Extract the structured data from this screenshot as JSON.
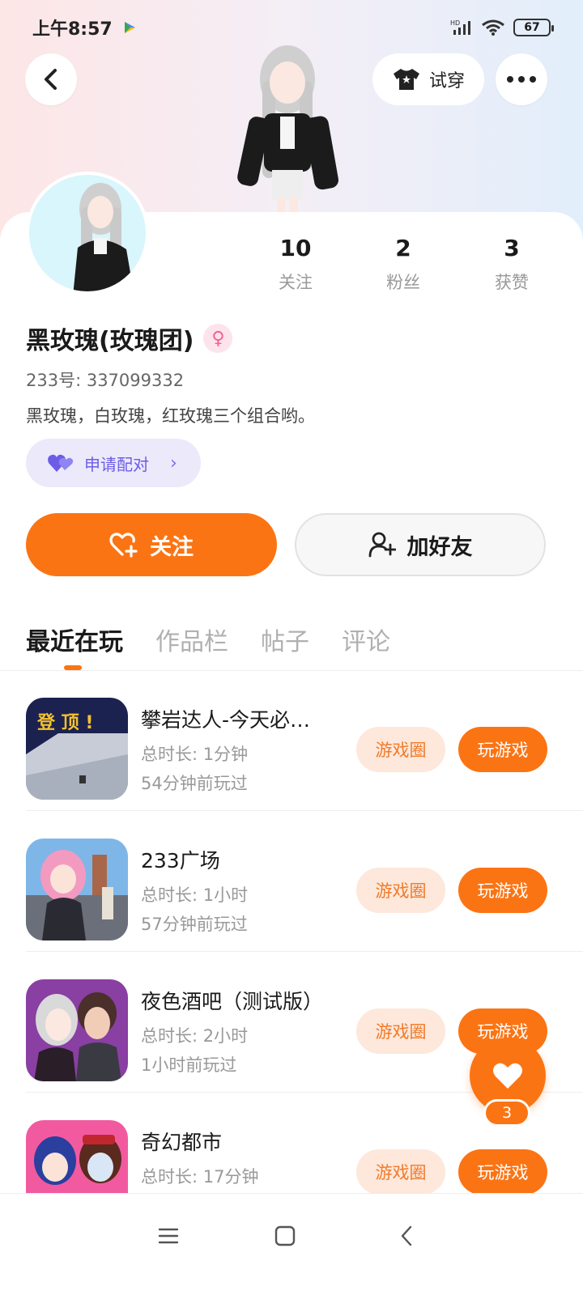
{
  "status_bar": {
    "time": "上午8:57",
    "battery": "67"
  },
  "header": {
    "tryon_label": "试穿"
  },
  "stats": [
    {
      "num": "10",
      "label": "关注"
    },
    {
      "num": "2",
      "label": "粉丝"
    },
    {
      "num": "3",
      "label": "获赞"
    }
  ],
  "profile": {
    "name": "黑玫瑰(玫瑰团)",
    "gender_symbol": "♀",
    "uid": "233号: 337099332",
    "bio": "黑玫瑰，白玫瑰，红玫瑰三个组合哟。",
    "pair_label": "申请配对"
  },
  "actions": {
    "follow_label": "关注",
    "add_friend_label": "加好友"
  },
  "tabs": [
    "最近在玩",
    "作品栏",
    "帖子",
    "评论"
  ],
  "games": [
    {
      "title": "攀岩达人-今天必…",
      "duration": "总时长: 1分钟",
      "last_played": "54分钟前玩过",
      "circle_label": "游戏圈",
      "play_label": "玩游戏",
      "icon_text": "登 顶 !"
    },
    {
      "title": "233广场",
      "duration": "总时长: 1小时",
      "last_played": "57分钟前玩过",
      "circle_label": "游戏圈",
      "play_label": "玩游戏"
    },
    {
      "title": "夜色酒吧（测试版）",
      "duration": "总时长: 2小时",
      "last_played": "1小时前玩过",
      "circle_label": "游戏圈",
      "play_label": "玩游戏"
    },
    {
      "title": "奇幻都市",
      "duration": "总时长: 17分钟",
      "last_played": "",
      "circle_label": "游戏圈",
      "play_label": "玩游戏"
    }
  ],
  "fab": {
    "count": "3"
  },
  "colors": {
    "accent": "#fb7414",
    "pair_purple": "#6c5ce7"
  }
}
